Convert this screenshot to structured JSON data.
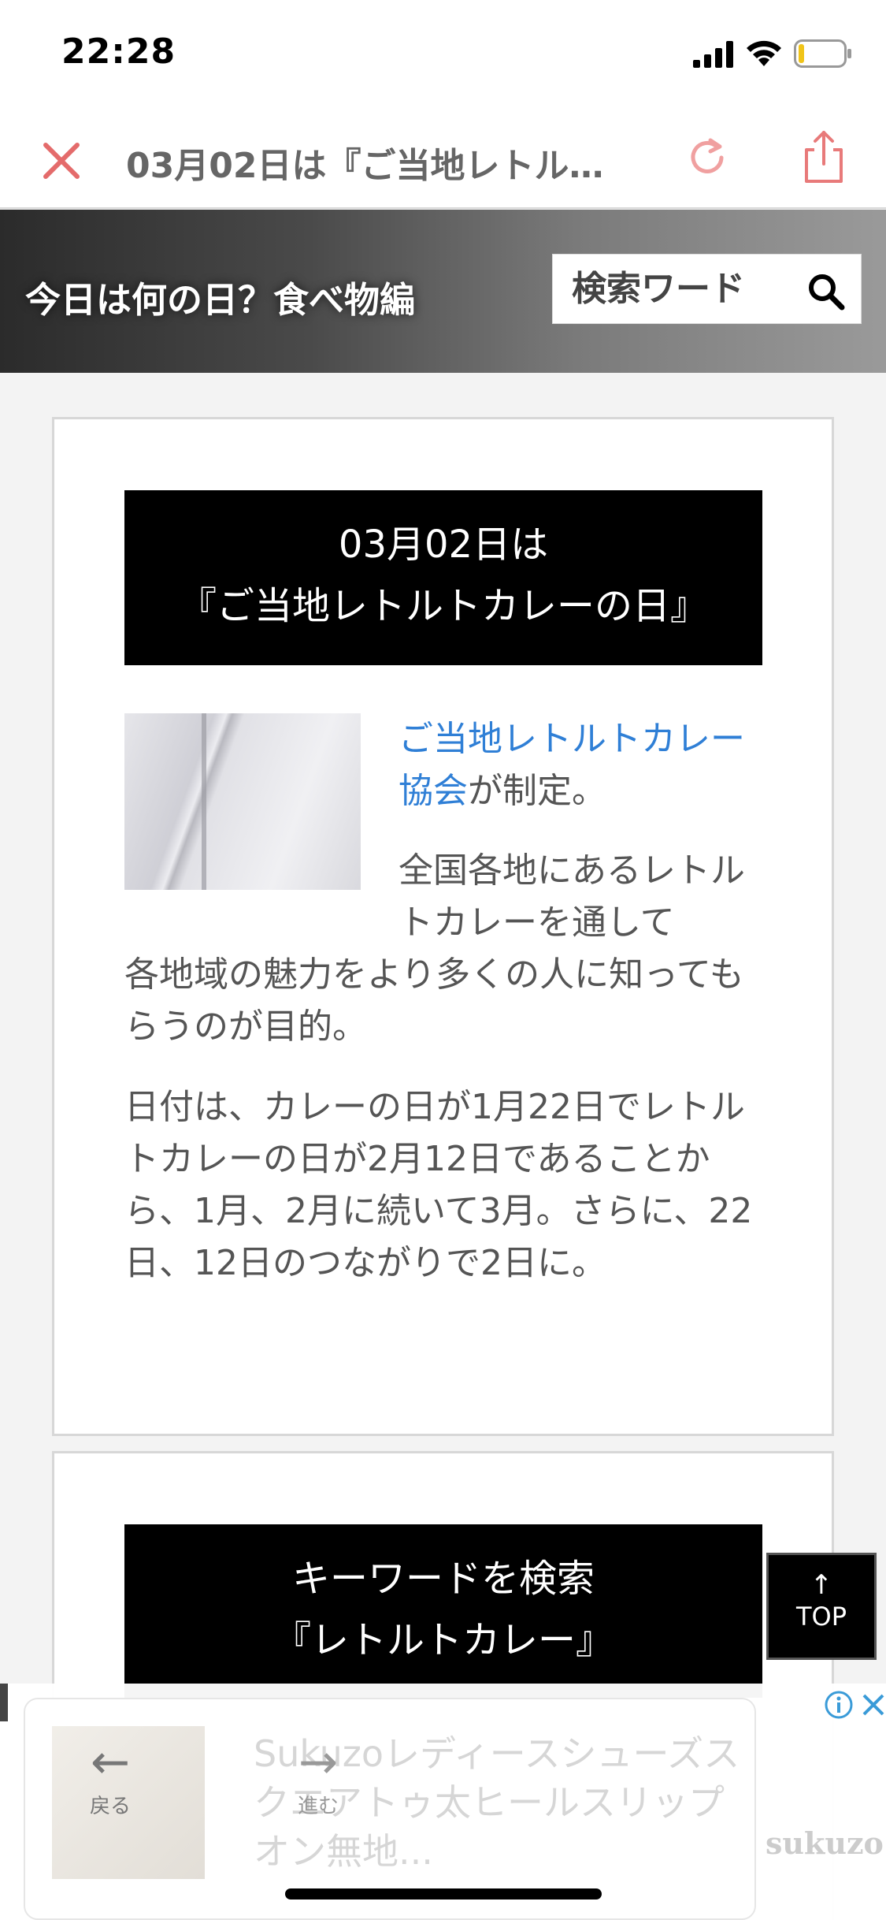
{
  "status_bar": {
    "time": "22:28"
  },
  "browser": {
    "title": "03月02日は『ご当地レトル…"
  },
  "site": {
    "title": "今日は何の日？食べ物編",
    "search_placeholder": "検索ワード"
  },
  "article": {
    "heading_line1": "03月02日は",
    "heading_line2": "『ご当地レトルトカレーの日』",
    "link_text": "ご当地レトルトカレー協会",
    "link_suffix": "が制定。",
    "para2_a": "全国各地にあるレトルトカレーを通して",
    "para2_b": "各地域の魅力をより多くの人に知ってもらうのが目的。",
    "para3": "日付は、カレーの日が1月22日でレトルトカレーの日が2月12日であることから、1月、2月に続いて3月。さらに、22日、12日のつながりで2日に。"
  },
  "keyword_section": {
    "heading_line1": "キーワードを検索",
    "heading_line2": "『レトルトカレー』"
  },
  "top_button": {
    "arrow": "↑",
    "label": "TOP"
  },
  "ad": {
    "text": "Sukuzoレディースシューズスクエアトゥ太ヒールスリップオン無地...",
    "brand": "sukuzo"
  },
  "toolbar": {
    "back_arrow": "←",
    "back_label": "戻る",
    "forward_arrow": "→",
    "forward_label": "進む"
  },
  "colors": {
    "link": "#2f7fd6",
    "close_icon": "#e46b6b",
    "reload_icon": "#f0a0a0",
    "share_icon": "#e87a7a"
  }
}
